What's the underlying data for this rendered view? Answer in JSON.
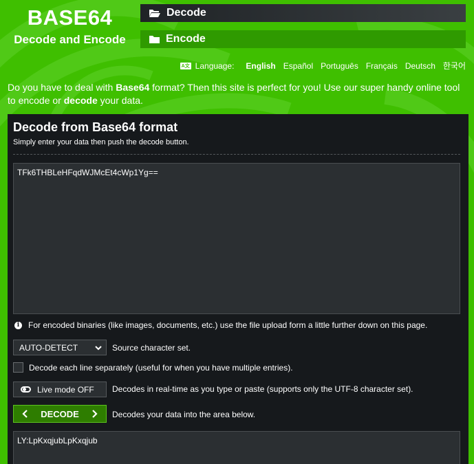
{
  "brand": {
    "title": "BASE64",
    "subtitle": "Decode and Encode"
  },
  "nav": {
    "decode_label": "Decode",
    "encode_label": "Encode"
  },
  "language": {
    "icon_text": "A文",
    "label": "Language:",
    "options": [
      "English",
      "Español",
      "Português",
      "Français",
      "Deutsch",
      "한국어"
    ],
    "active": "English"
  },
  "intro": {
    "part1": "Do you have to deal with ",
    "bold1": "Base64",
    "part2": " format? Then this site is perfect for you! Use our super handy online tool to encode or ",
    "bold2": "decode",
    "part3": " your data."
  },
  "panel": {
    "title": "Decode from Base64 format",
    "subtitle": "Simply enter your data then push the decode button.",
    "input_value": "TFk6THBLeHFqdWJMcEt4cWp1Yg==",
    "info_text": "For encoded binaries (like images, documents, etc.) use the file upload form a little further down on this page.",
    "charset_value": "AUTO-DETECT",
    "charset_label": "Source character set.",
    "lines_label": "Decode each line separately (useful for when you have multiple entries).",
    "live_label": "Live mode OFF",
    "live_desc": "Decodes in real-time as you type or paste (supports only the UTF-8 character set).",
    "decode_button": "DECODE",
    "decode_desc": "Decodes your data into the area below.",
    "output_value": "LY:LpKxqjubLpKxqjub"
  },
  "colors": {
    "background": "#3fbf00",
    "panel": "#16191c",
    "decode_button": "#2e7d00"
  }
}
